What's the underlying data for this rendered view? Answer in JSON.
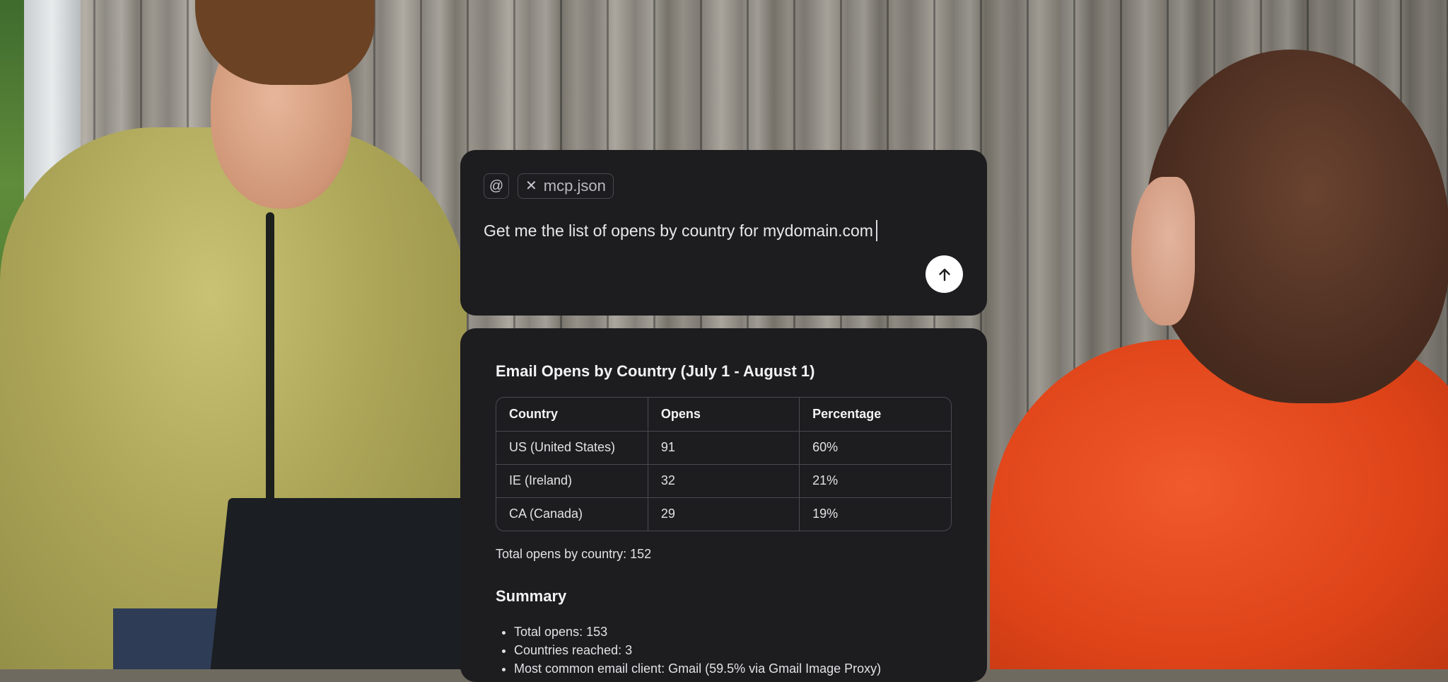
{
  "input": {
    "mention_symbol": "@",
    "attachment": {
      "close_symbol": "✕",
      "filename": "mcp.json"
    },
    "prompt_text": "Get me the list of opens by country for mydomain.com",
    "send_icon": "arrow-up-icon"
  },
  "result": {
    "title": "Email Opens by Country (July 1 - August 1)",
    "table": {
      "headers": [
        "Country",
        "Opens",
        "Percentage"
      ],
      "rows": [
        [
          "US (United States)",
          "91",
          "60%"
        ],
        [
          "IE (Ireland)",
          "32",
          "21%"
        ],
        [
          "CA (Canada)",
          "29",
          "19%"
        ]
      ]
    },
    "total_line": "Total opens by country: 152",
    "summary_title": "Summary",
    "summary_items": [
      "Total opens: 153",
      "Countries reached: 3",
      "Most common email client: Gmail (59.5% via Gmail Image Proxy)"
    ]
  },
  "colors": {
    "card_background": "#1d1c1f",
    "send_button": "#ffffff",
    "coat": "#de4318",
    "jacket": "#ada659"
  }
}
